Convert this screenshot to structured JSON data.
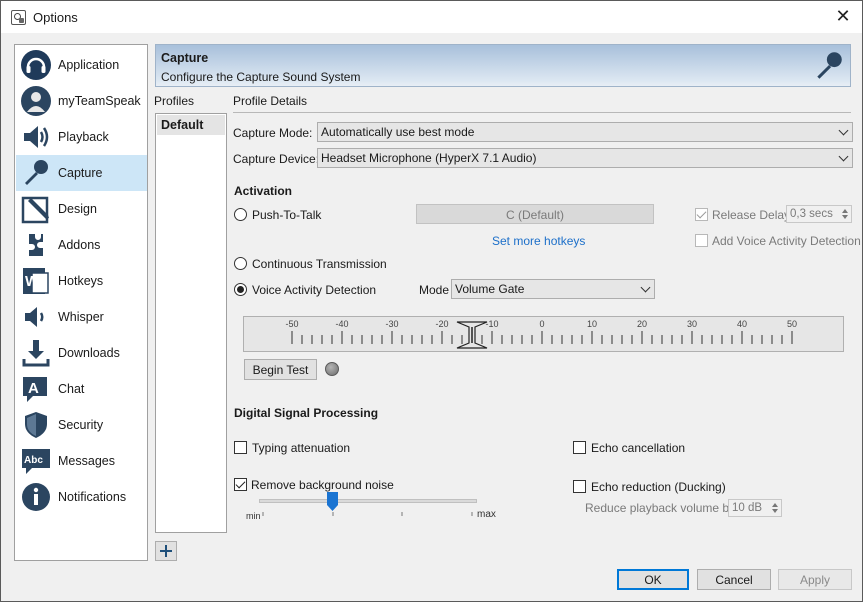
{
  "window": {
    "title": "Options"
  },
  "sidebar": {
    "items": [
      {
        "label": "Application",
        "icon": "headset-icon"
      },
      {
        "label": "myTeamSpeak",
        "icon": "user-icon"
      },
      {
        "label": "Playback",
        "icon": "speaker-icon"
      },
      {
        "label": "Capture",
        "icon": "microphone-icon",
        "selected": true
      },
      {
        "label": "Design",
        "icon": "pen-icon"
      },
      {
        "label": "Addons",
        "icon": "puzzle-icon"
      },
      {
        "label": "Hotkeys",
        "icon": "keyboard-icon"
      },
      {
        "label": "Whisper",
        "icon": "whisper-speaker-icon"
      },
      {
        "label": "Downloads",
        "icon": "download-icon"
      },
      {
        "label": "Chat",
        "icon": "chat-icon"
      },
      {
        "label": "Security",
        "icon": "shield-icon"
      },
      {
        "label": "Messages",
        "icon": "messages-icon"
      },
      {
        "label": "Notifications",
        "icon": "info-icon"
      }
    ]
  },
  "header": {
    "title": "Capture",
    "subtitle": "Configure the Capture Sound System"
  },
  "profiles": {
    "label": "Profiles",
    "items": [
      "Default"
    ]
  },
  "details": {
    "label": "Profile Details",
    "capture_mode_label": "Capture Mode:",
    "capture_mode_value": "Automatically use best mode",
    "capture_device_label": "Capture Device:",
    "capture_device_value": "Headset Microphone (HyperX 7.1 Audio)"
  },
  "activation": {
    "heading": "Activation",
    "push_to_talk": "Push-To-Talk",
    "hotkey_value": "C (Default)",
    "set_more_hotkeys": "Set more hotkeys",
    "release_delay_label": "Release Delay",
    "release_delay_value": "0,3 secs",
    "add_vad": "Add Voice Activity Detection",
    "continuous": "Continuous Transmission",
    "vad": "Voice Activity Detection",
    "mode_label": "Mode",
    "mode_value": "Volume Gate"
  },
  "meter": {
    "scale": [
      "-50",
      "-40",
      "-30",
      "-20",
      "-10",
      "0",
      "10",
      "20",
      "30",
      "40",
      "50"
    ],
    "threshold": -14,
    "begin_test": "Begin Test"
  },
  "dsp": {
    "heading": "Digital Signal Processing",
    "typing_attenuation": "Typing attenuation",
    "echo_cancellation": "Echo cancellation",
    "remove_noise": "Remove background noise",
    "echo_reduction": "Echo reduction (Ducking)",
    "reduce_volume_label": "Reduce playback volume by:",
    "reduce_volume_value": "10 dB",
    "slider_min": "min",
    "slider_max": "max",
    "slider_value": 0.33
  },
  "footer": {
    "ok": "OK",
    "cancel": "Cancel",
    "apply": "Apply"
  }
}
